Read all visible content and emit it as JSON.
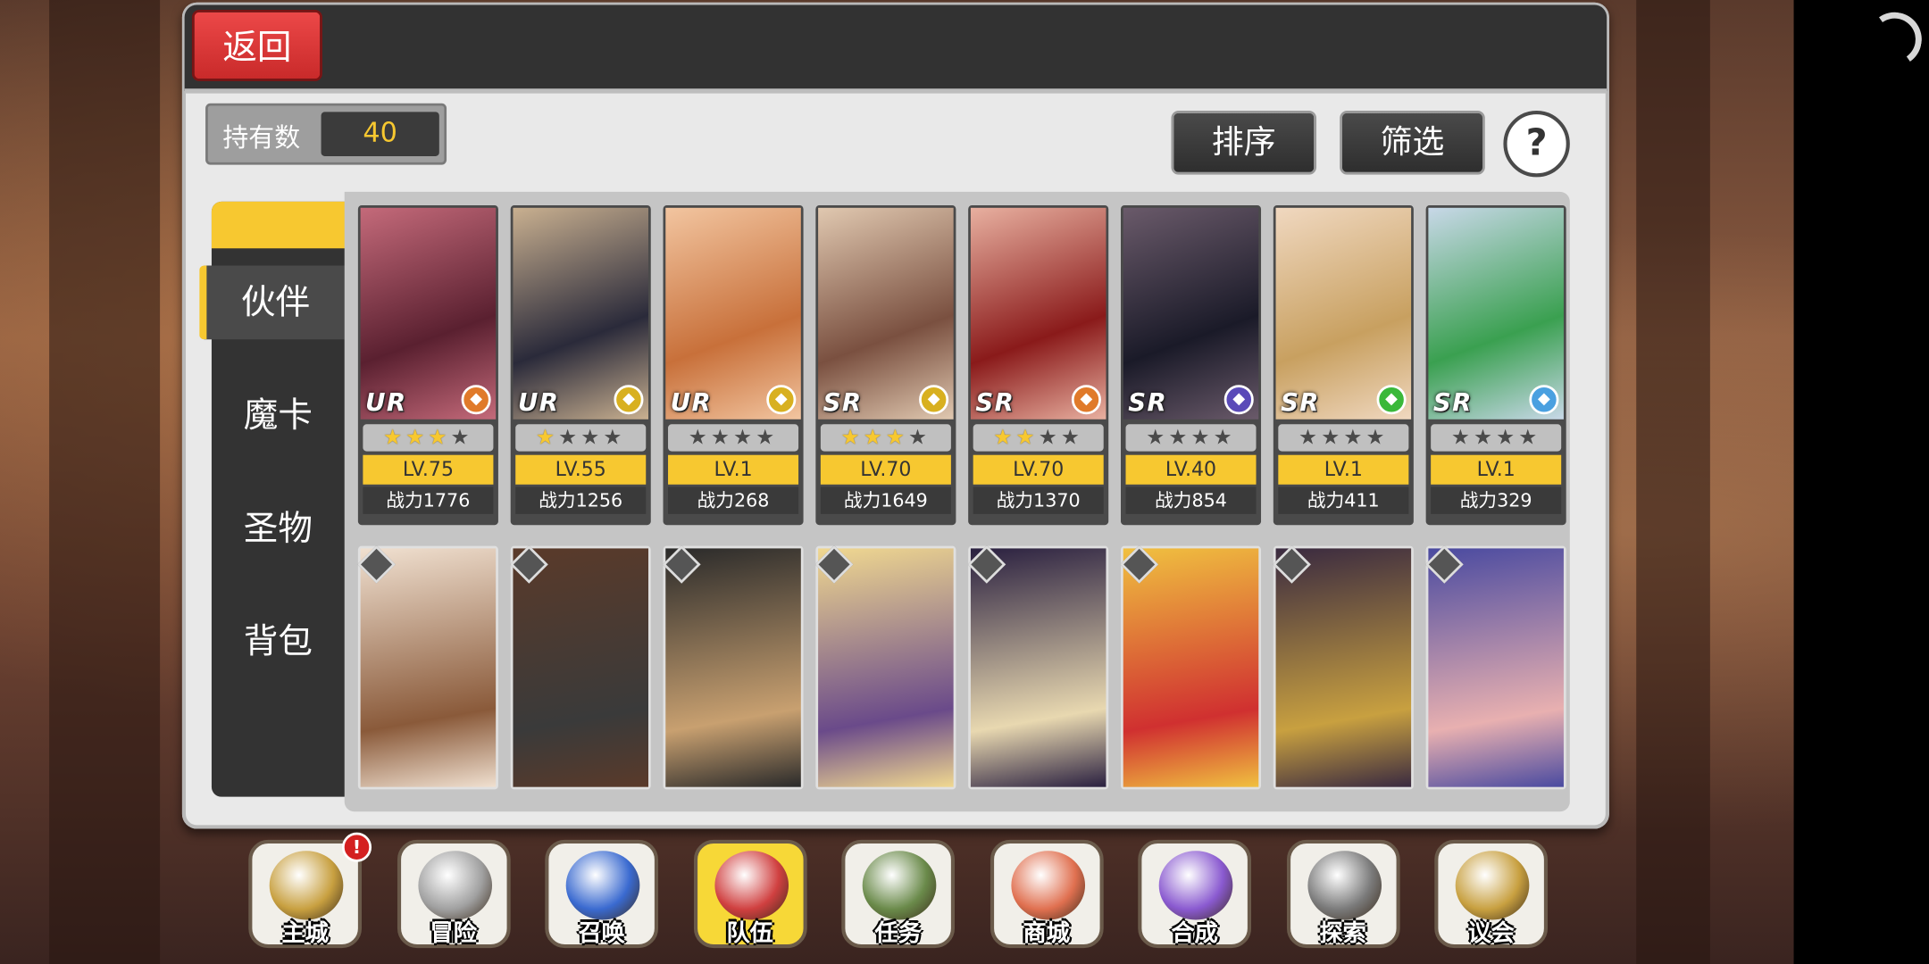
{
  "header": {
    "back_label": "返回"
  },
  "owned": {
    "label": "持有数",
    "count": "40"
  },
  "toolbar": {
    "sort_label": "排序",
    "filter_label": "筛选",
    "help_label": "?"
  },
  "side_tabs": [
    {
      "label": "伙伴",
      "active": true
    },
    {
      "label": "魔卡",
      "active": false
    },
    {
      "label": "圣物",
      "active": false
    },
    {
      "label": "背包",
      "active": false
    }
  ],
  "cards_row1": [
    {
      "rarity": "UR",
      "stars": 3,
      "level": "LV.75",
      "power": "战力1776",
      "element": "axe-icon",
      "color": "#e07a2a"
    },
    {
      "rarity": "UR",
      "stars": 1,
      "level": "LV.55",
      "power": "战力1256",
      "element": "wing-icon",
      "color": "#d8b020"
    },
    {
      "rarity": "UR",
      "stars": 0,
      "level": "LV.1",
      "power": "战力268",
      "element": "cross-icon",
      "color": "#d8b020"
    },
    {
      "rarity": "SR",
      "stars": 3,
      "level": "LV.70",
      "power": "战力1649",
      "element": "bow-icon",
      "color": "#d8b020"
    },
    {
      "rarity": "SR",
      "stars": 2,
      "level": "LV.70",
      "power": "战力1370",
      "element": "axe-icon",
      "color": "#e07a2a"
    },
    {
      "rarity": "SR",
      "stars": 0,
      "level": "LV.40",
      "power": "战力854",
      "element": "shield-icon",
      "color": "#5a4ab8"
    },
    {
      "rarity": "SR",
      "stars": 0,
      "level": "LV.1",
      "power": "战力411",
      "element": "leaf-icon",
      "color": "#3ab83a"
    },
    {
      "rarity": "SR",
      "stars": 0,
      "level": "LV.1",
      "power": "战力329",
      "element": "wing-icon",
      "color": "#4aa0e0"
    }
  ],
  "bottom_nav": [
    {
      "label": "主城",
      "icon": "crown-icon",
      "active": false,
      "alert": "!"
    },
    {
      "label": "冒险",
      "icon": "swords-icon",
      "active": false
    },
    {
      "label": "召唤",
      "icon": "card-icon",
      "active": false
    },
    {
      "label": "队伍",
      "icon": "emblem-icon",
      "active": true
    },
    {
      "label": "任务",
      "icon": "book-icon",
      "active": false
    },
    {
      "label": "商城",
      "icon": "shop-icon",
      "active": false
    },
    {
      "label": "合成",
      "icon": "potion-icon",
      "active": false
    },
    {
      "label": "探索",
      "icon": "compass-icon",
      "active": false
    },
    {
      "label": "议会",
      "icon": "council-icon",
      "active": false
    }
  ]
}
